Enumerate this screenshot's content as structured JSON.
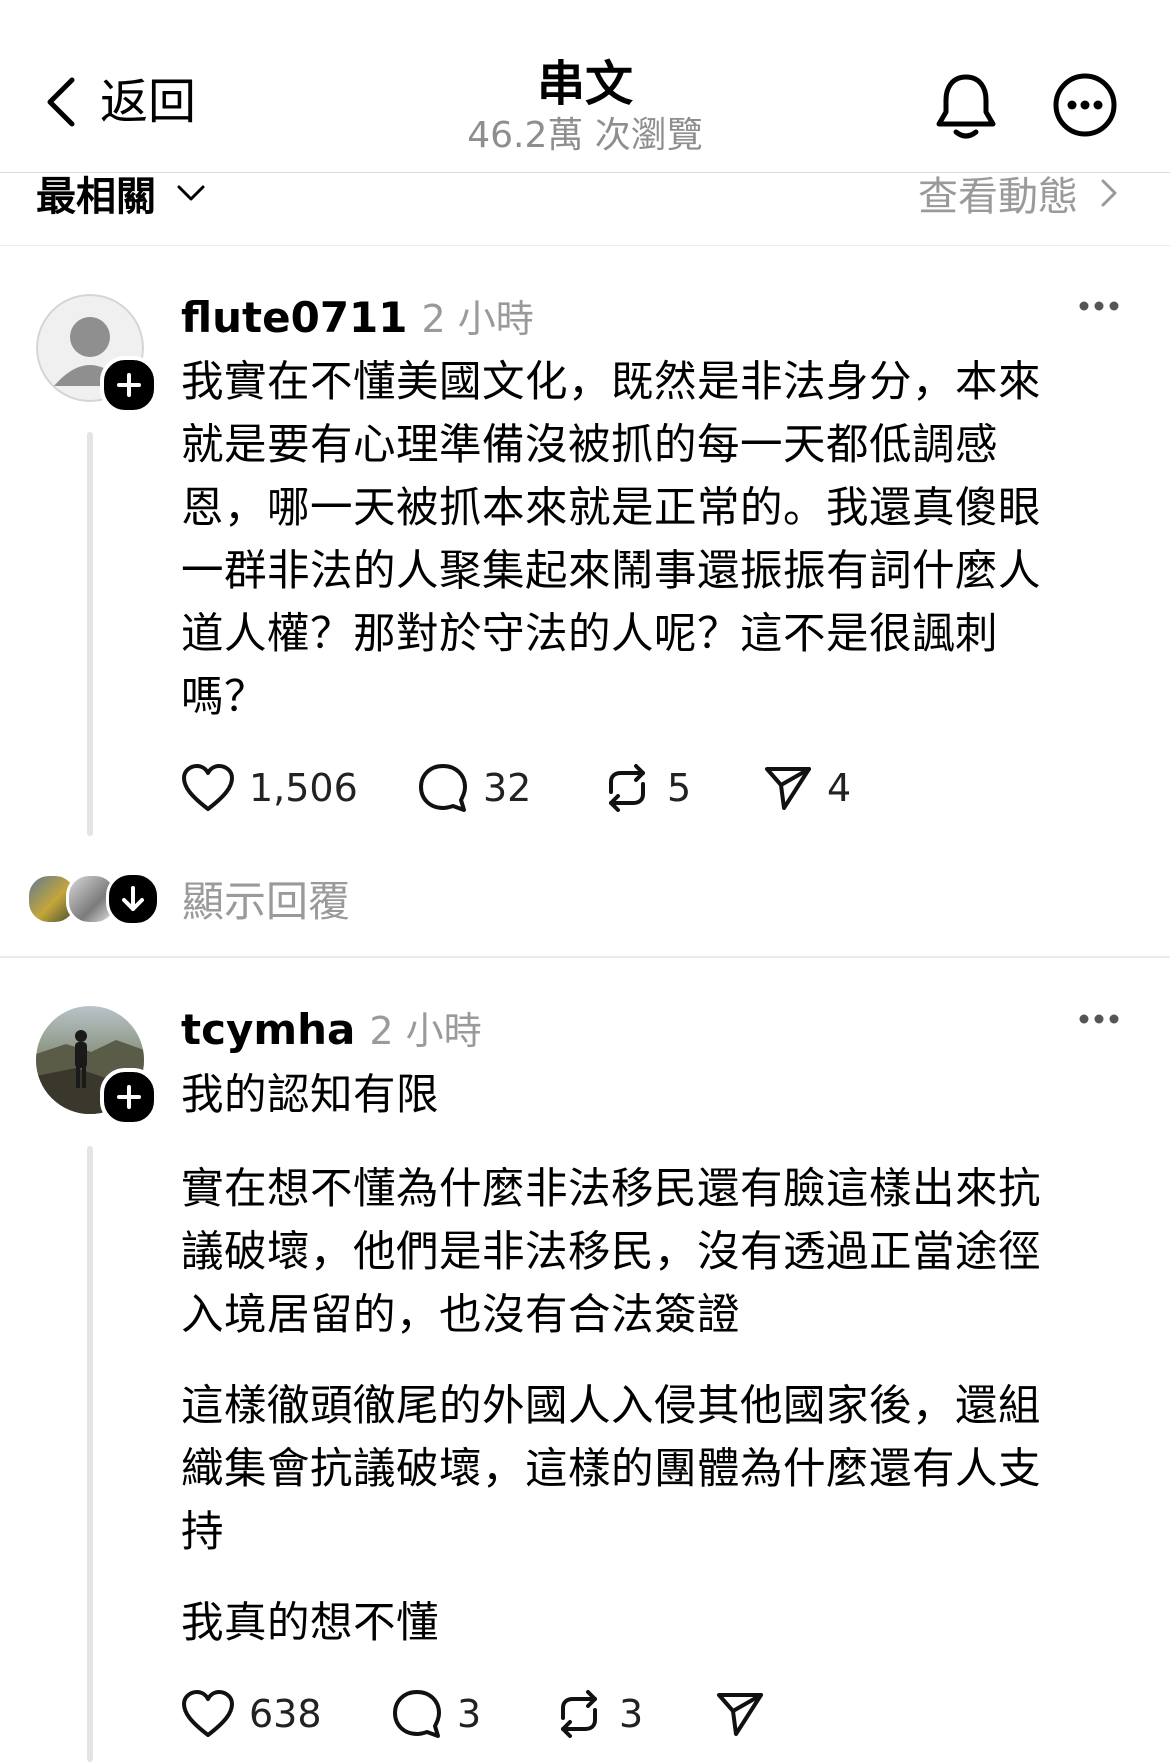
{
  "header": {
    "back_label": "返回",
    "title": "串文",
    "views": "46.2萬 次瀏覽"
  },
  "sort_bar": {
    "left_label": "最相關",
    "right_label": "查看動態"
  },
  "posts": [
    {
      "username": "flute0711",
      "time": "2 小時",
      "lines": [
        "我實在不懂美國文化，既然是非法身分，本來",
        "就是要有心理準備沒被抓的每一天都低調感",
        "恩，哪一天被抓本來就是正常的。我還真傻眼",
        "一群非法的人聚集起來鬧事還振振有詞什麼人",
        "道人權？那對於守法的人呢？這不是很諷刺",
        "嗎？"
      ],
      "likes": "1,506",
      "comments": "32",
      "reposts": "5",
      "shares": "4"
    },
    {
      "username": "tcymha",
      "time": "2 小時",
      "paragraphs": [
        [
          "我的認知有限"
        ],
        [
          "實在想不懂為什麼非法移民還有臉這樣出來抗",
          "議破壞，他們是非法移民，沒有透過正當途徑",
          "入境居留的，也沒有合法簽證"
        ],
        [
          "這樣徹頭徹尾的外國人入侵其他國家後，還組",
          "織集會抗議破壞，這樣的團體為什麼還有人支",
          "持"
        ],
        [
          "我真的想不懂"
        ]
      ],
      "likes": "638",
      "comments": "3",
      "reposts": "3",
      "shares": ""
    }
  ],
  "replies_row": {
    "label": "顯示回覆"
  },
  "colors": {
    "text": "#000000",
    "muted": "#9a9a9a",
    "divider": "#ebebeb",
    "thread_line": "#e4e4e4"
  }
}
